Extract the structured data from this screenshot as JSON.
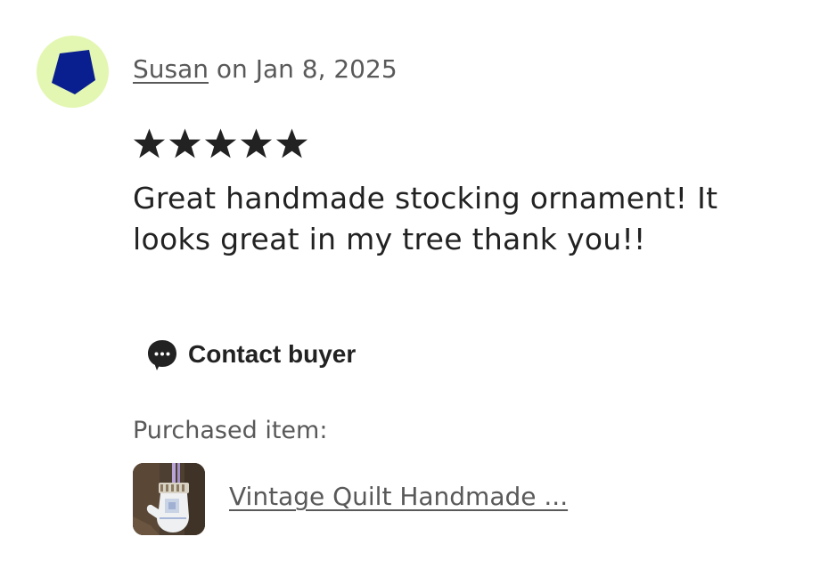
{
  "review": {
    "reviewer_name": "Susan",
    "date_text": " on Jan 8, 2025",
    "rating": 5,
    "rating_max": 5,
    "text": "Great handmade stocking ornament! It looks great in my tree thank you!!",
    "avatar": {
      "icon": "pentagon-icon",
      "background_color": "#e3f7b2",
      "shape_color": "#0a1f8f"
    }
  },
  "actions": {
    "contact_label": "Contact buyer",
    "contact_icon": "chat-bubble-icon"
  },
  "purchase": {
    "label": "Purchased item:",
    "item_title": "Vintage Quilt Handmade ...",
    "thumbnail_icon": "mitten-ornament-image"
  }
}
